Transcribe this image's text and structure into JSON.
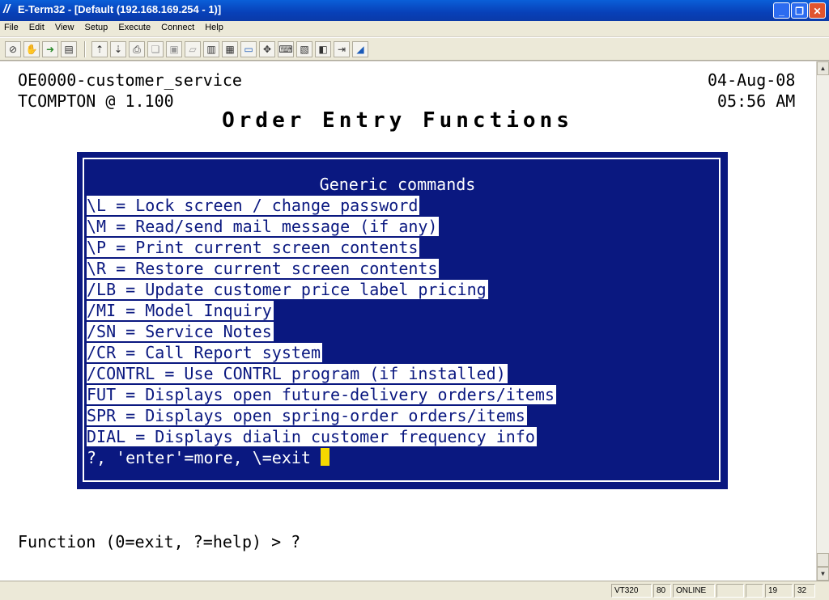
{
  "window": {
    "title": "E-Term32 - [Default (192.168.169.254 - 1)]",
    "buttons": {
      "minimize": "_",
      "restore": "❐",
      "close": "✕"
    }
  },
  "menu": [
    "File",
    "Edit",
    "View",
    "Setup",
    "Execute",
    "Connect",
    "Help"
  ],
  "toolbar": {
    "icons": [
      "disconnect-icon",
      "hand-icon",
      "connect-icon",
      "printer-setup-icon",
      "send-file-icon",
      "receive-file-icon",
      "print-icon",
      "copy-icon",
      "paste-icon",
      "clear-icon",
      "capture-icon",
      "log-icon",
      "screen-icon",
      "settings-icon",
      "keyboard-icon",
      "terminal-icon",
      "macro-icon",
      "exit-icon",
      "help-icon"
    ]
  },
  "screen": {
    "program": "OE0000-customer_service",
    "date": "04-Aug-08",
    "user": "TCOMPTON @ 1.100",
    "time": "05:56 AM",
    "title": "Order Entry Functions",
    "popup": {
      "heading": "Generic commands",
      "commands": [
        "\\L = Lock screen / change password",
        "\\M = Read/send mail message (if any)",
        "\\P = Print current screen contents",
        "\\R = Restore current screen contents",
        "/LB = Update customer price label pricing",
        "/MI = Model Inquiry",
        "/SN = Service Notes",
        "/CR = Call Report system",
        "/CONTRL = Use CONTRL program (if installed)",
        "FUT = Displays open future-delivery orders/items",
        "SPR = Displays open spring-order orders/items",
        "DIAL = Displays dialin customer frequency info"
      ],
      "prompt": "?, 'enter'=more, \\=exit"
    },
    "function_prompt": "Function (0=exit, ?=help) > ?"
  },
  "statusbar": {
    "emulation": "VT320",
    "columns": "80",
    "state": "ONLINE",
    "row": "19",
    "col": "32"
  }
}
